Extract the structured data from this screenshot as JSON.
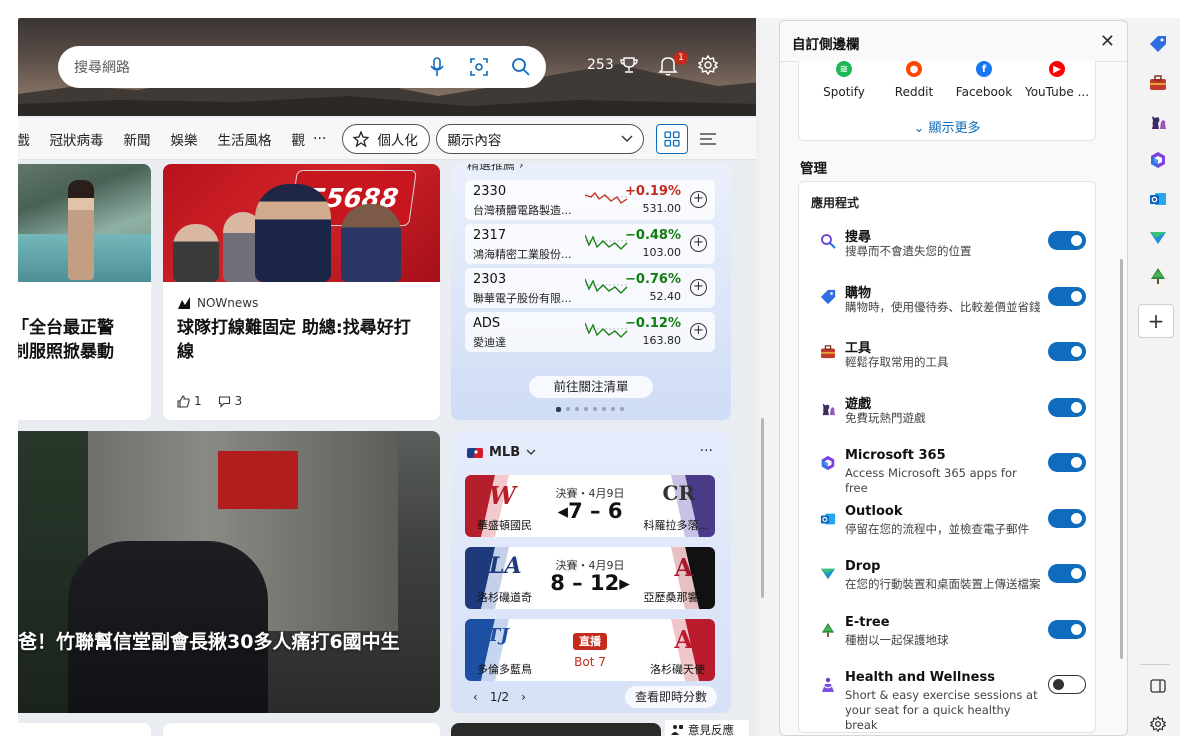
{
  "hero": {
    "search_placeholder": "搜尋網路",
    "points": "253",
    "notif_count": "1"
  },
  "nav": {
    "items": [
      "戲",
      "冠狀病毒",
      "新聞",
      "娛樂",
      "生活風格",
      "觀"
    ],
    "more": "···",
    "personalize": "個人化",
    "display": "顯示內容"
  },
  "cards": {
    "c1_title": "「全台最正警\n制服照掀暴動",
    "c2_source": "NOWnews",
    "c2_title": "球隊打線難固定 助總:找尋好打線",
    "c2_likes": "1",
    "c2_comments": "3",
    "c2_panel": "55688",
    "big_title": "爸！竹聯幫信堂副會長揪30多人痛打6國中生"
  },
  "stocks": {
    "header": "精選推薦 ›",
    "rows": [
      {
        "symbol": "2330",
        "name": "台灣積體電路製造...",
        "change": "+0.19%",
        "price": "531.00",
        "dir": "up"
      },
      {
        "symbol": "2317",
        "name": "鴻海精密工業股份...",
        "change": "−0.48%",
        "price": "103.00",
        "dir": "down"
      },
      {
        "symbol": "2303",
        "name": "聯華電子股份有限...",
        "change": "−0.76%",
        "price": "52.40",
        "dir": "down"
      },
      {
        "symbol": "ADS",
        "name": "愛迪達",
        "change": "−0.12%",
        "price": "163.80",
        "dir": "down"
      }
    ],
    "goto": "前往關注清單"
  },
  "mlb": {
    "title": "MLB",
    "games": [
      {
        "meta": "決賽・4月9日",
        "score": "◂7 – 6",
        "home": "華盛頓國民",
        "away": "科羅拉多落...",
        "home_logo": "W",
        "away_logo": "CR"
      },
      {
        "meta": "決賽・4月9日",
        "score": "8 – 12▸",
        "home": "洛杉磯道奇",
        "away": "亞歷桑那響...",
        "home_logo": "LA",
        "away_logo": "A"
      },
      {
        "live": "直播",
        "bot": "Bot 7",
        "home": "多倫多藍鳥",
        "away": "洛杉磯天使",
        "home_logo": "TJ",
        "away_logo": "A"
      }
    ],
    "pager": "1/2",
    "live_scores": "查看即時分數"
  },
  "feedback": "意見反應",
  "panel": {
    "title": "自訂側邊欄",
    "quick_links": [
      "Spotify",
      "Reddit",
      "Facebook",
      "YouTube ..."
    ],
    "show_more": "顯示更多",
    "manage": "管理",
    "apps_header": "應用程式",
    "apps": [
      {
        "name": "搜尋",
        "desc": "搜尋而不會遺失您的位置",
        "on": true
      },
      {
        "name": "購物",
        "desc": "購物時，使用優待券、比較差價並省錢",
        "on": true
      },
      {
        "name": "工具",
        "desc": "輕鬆存取常用的工具",
        "on": true
      },
      {
        "name": "遊戲",
        "desc": "免費玩熱門遊戲",
        "on": true
      },
      {
        "name": "Microsoft 365",
        "desc": "Access Microsoft 365 apps for free",
        "on": true
      },
      {
        "name": "Outlook",
        "desc": "停留在您的流程中，並檢查電子郵件",
        "on": true
      },
      {
        "name": "Drop",
        "desc": "在您的行動裝置和桌面裝置上傳送檔案",
        "on": true
      },
      {
        "name": "E-tree",
        "desc": "種樹以一起保護地球",
        "on": true
      },
      {
        "name": "Health and Wellness",
        "desc": "Short & easy exercise sessions at your seat for a quick healthy break",
        "on": false
      }
    ]
  },
  "colors": {
    "accent": "#0f6cbd",
    "up": "#c42b1c",
    "down": "#107c10"
  }
}
